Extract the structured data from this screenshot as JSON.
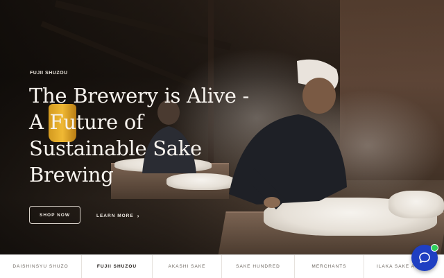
{
  "hero": {
    "eyebrow": "FUJII SHUZOU",
    "headline": "The Brewery is Alive - A Future of Sustainable Sake Brewing",
    "primary_cta": "SHOP NOW",
    "secondary_cta": "LEARN MORE",
    "secondary_cta_icon": "chevron-right-icon"
  },
  "bottom_nav": {
    "items": [
      {
        "label": "DAISHINSYU SHUZO",
        "active": false
      },
      {
        "label": "FUJII SHUZOU",
        "active": true
      },
      {
        "label": "AKASHI SAKE",
        "active": false
      },
      {
        "label": "SAKE HUNDRED",
        "active": false
      },
      {
        "label": "MERCHANTS",
        "active": false
      },
      {
        "label": "ILAKA SAKE AT",
        "active": false
      }
    ]
  },
  "chat": {
    "icon": "chat-bubble-icon",
    "status_color": "#2fcf5a",
    "button_color": "#1f3fc2"
  }
}
